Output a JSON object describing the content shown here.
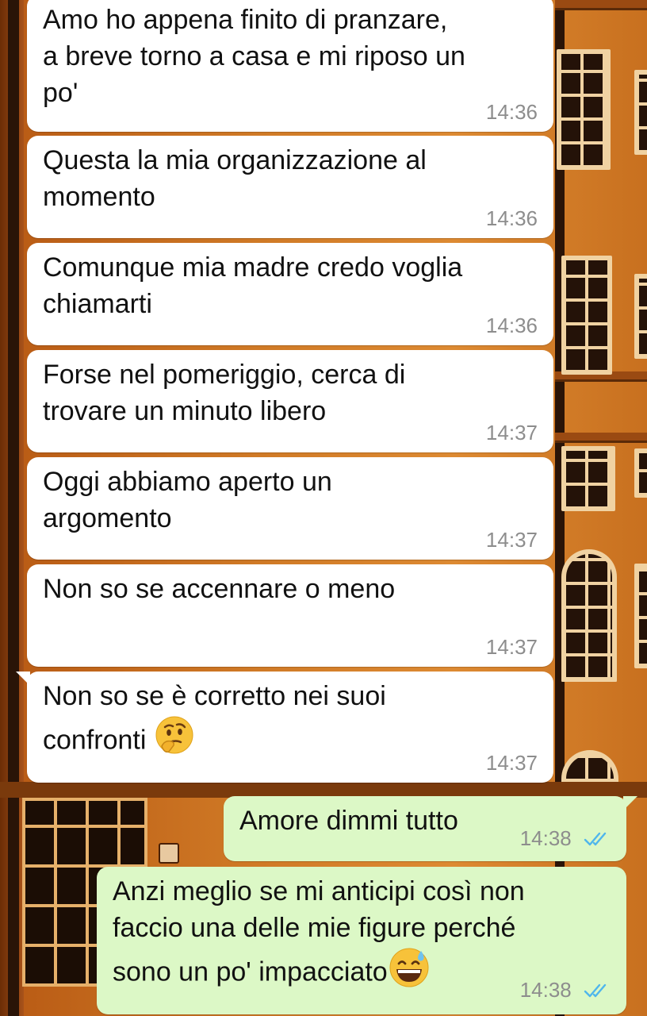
{
  "colors": {
    "incoming_bubble": "#ffffff",
    "outgoing_bubble": "#dcf8c6",
    "timestamp": "#8d8d8d",
    "read_ticks": "#4fb6ec"
  },
  "messages": [
    {
      "direction": "incoming",
      "lines": [
        "Amo ho appena finito di pranzare,",
        "a breve torno a casa e mi riposo un",
        "po'"
      ],
      "time": "14:36"
    },
    {
      "direction": "incoming",
      "lines": [
        "Questa la mia organizzazione al",
        "momento"
      ],
      "time": "14:36"
    },
    {
      "direction": "incoming",
      "lines": [
        "Comunque mia madre credo voglia",
        "chiamarti"
      ],
      "time": "14:36"
    },
    {
      "direction": "incoming",
      "lines": [
        "Forse nel pomeriggio, cerca di",
        "trovare un minuto libero"
      ],
      "time": "14:37"
    },
    {
      "direction": "incoming",
      "lines": [
        "Oggi abbiamo aperto un",
        "argomento"
      ],
      "time": "14:37"
    },
    {
      "direction": "incoming",
      "lines": [
        "Non so se accennare o meno"
      ],
      "time": "14:37"
    },
    {
      "direction": "incoming",
      "lines": [
        "Non so se è corretto nei suoi",
        "confronti"
      ],
      "emoji": "thinking-face-emoji",
      "time": "14:37"
    },
    {
      "direction": "outgoing",
      "lines": [
        "Amore dimmi tutto"
      ],
      "time": "14:38",
      "status": "read-double-check-icon"
    },
    {
      "direction": "outgoing",
      "lines": [
        "Anzi meglio se mi anticipi così non",
        "faccio una delle mie figure perché",
        "sono un po' impacciato"
      ],
      "emoji": "grinning-sweat-emoji",
      "time": "14:38",
      "status": "read-double-check-icon"
    }
  ]
}
